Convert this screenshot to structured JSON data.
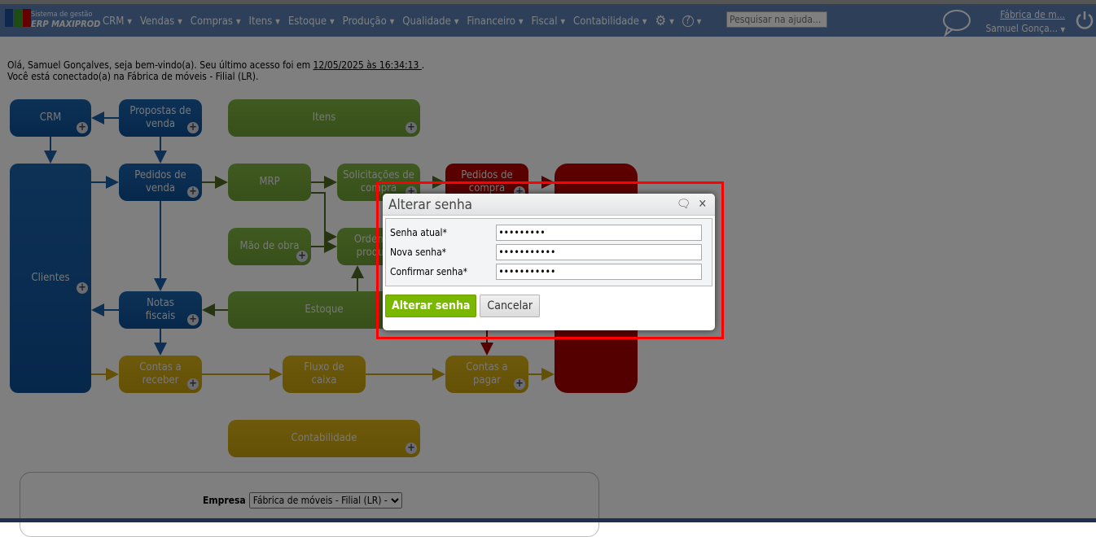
{
  "header": {
    "brand_small": "Sistema de gestão",
    "brand_name": "ERP MAXIPROD",
    "menu": [
      "CRM",
      "Vendas",
      "Compras",
      "Itens",
      "Estoque",
      "Produção",
      "Qualidade",
      "Financeiro",
      "Fiscal",
      "Contabilidade"
    ],
    "search_placeholder": "Pesquisar na ajuda...",
    "company_link": "Fábrica de m...",
    "user_name": "Samuel Gonça..."
  },
  "welcome": {
    "line1_prefix": "Olá, Samuel Gonçalves, seja bem-vindo(a). Seu último acesso foi em ",
    "last_access": "12/05/2025 às 16:34:13 ",
    "line1_suffix": ".",
    "line2": "Você está conectado(a) na Fábrica de móveis - Filial (LR)."
  },
  "flow": {
    "crm": "CRM",
    "propostas": "Propostas de venda",
    "itens": "Itens",
    "clientes": "Clientes",
    "pedidos_venda": "Pedidos de venda",
    "mrp": "MRP",
    "solicitacoes": "Solicitações de compra",
    "pedidos_compra": "Pedidos de compra",
    "mao_obra": "Mão de obra",
    "ordens": "Ordens de produção",
    "notas": "Notas fiscais",
    "estoque": "Estoque",
    "contas_receber": "Contas a receber",
    "fluxo": "Fluxo de caixa",
    "contas_pagar": "Contas a pagar",
    "contabilidade": "Contabilidade"
  },
  "panel": {
    "empresa_label": "Empresa",
    "empresa_value": "Fábrica de móveis - Filial (LR) -"
  },
  "dialog": {
    "title": "Alterar senha",
    "fields": [
      {
        "label": "Senha atual*",
        "value": "123456789"
      },
      {
        "label": "Nova senha*",
        "value": "12345678901"
      },
      {
        "label": "Confirmar senha*",
        "value": "12345678901"
      }
    ],
    "ok": "Alterar senha",
    "cancel": "Cancelar"
  },
  "colors": {
    "header": "#5c80b2",
    "blue": "#145caa",
    "green": "#78b43c",
    "gold": "#dcb414",
    "red": "#b40000",
    "ok": "#7ab800",
    "highlight": "#ff0000"
  }
}
